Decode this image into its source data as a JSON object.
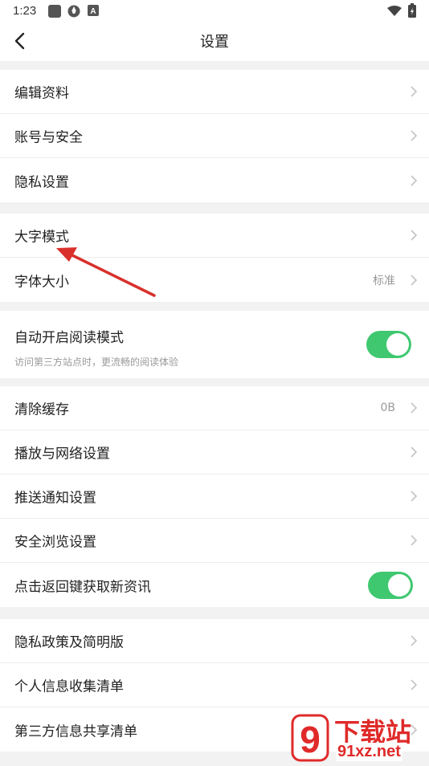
{
  "status": {
    "time": "1:23"
  },
  "header": {
    "title": "设置"
  },
  "group1": [
    {
      "label": "编辑资料"
    },
    {
      "label": "账号与安全"
    },
    {
      "label": "隐私设置"
    }
  ],
  "group2": [
    {
      "label": "大字模式"
    },
    {
      "label": "字体大小",
      "value": "标准"
    }
  ],
  "group3": {
    "label": "自动开启阅读模式",
    "description": "访问第三方站点时，更流畅的阅读体验",
    "toggle_on": true
  },
  "group4": [
    {
      "label": "清除缓存",
      "value": "0B"
    },
    {
      "label": "播放与网络设置"
    },
    {
      "label": "推送通知设置"
    },
    {
      "label": "安全浏览设置"
    },
    {
      "label": "点击返回键获取新资讯",
      "toggle_on": true
    }
  ],
  "group5": [
    {
      "label": "隐私政策及简明版"
    },
    {
      "label": "个人信息收集清单"
    },
    {
      "label": "第三方信息共享清单"
    }
  ],
  "watermark": {
    "brand": "下载站",
    "domain": "91xz.net",
    "logo_glyph": "9"
  },
  "colors": {
    "toggle": "#3fc870",
    "annotation_arrow": "#d9302c",
    "watermark": "#e02a2a"
  }
}
